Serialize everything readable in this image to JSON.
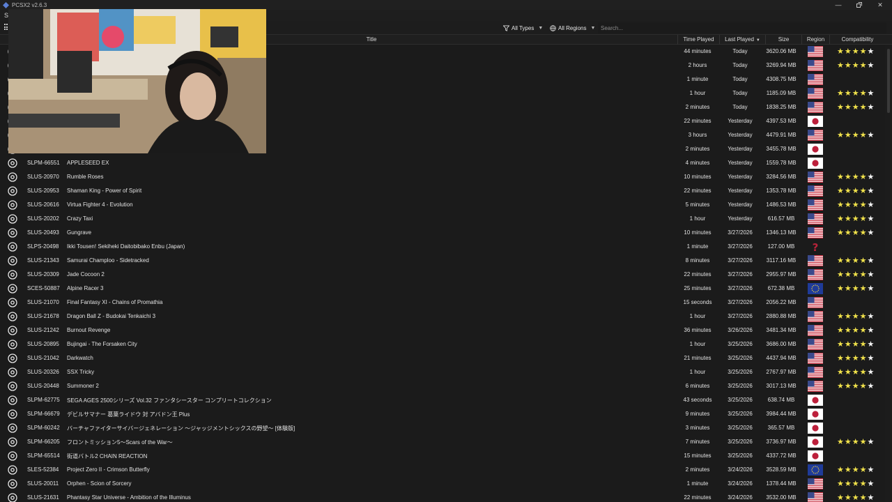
{
  "window": {
    "title": "PCSX2 v2.6.3"
  },
  "menubar": {
    "first_item": "S"
  },
  "toolbar": {
    "type_filter": "All Types",
    "region_filter": "All Regions",
    "search_placeholder": "Search..."
  },
  "columns": {
    "title": "Title",
    "time_played": "Time Played",
    "last_played": "Last Played",
    "size": "Size",
    "region": "Region",
    "compatibility": "Compatibility"
  },
  "colors": {
    "background": "#1b1b1b",
    "star_filled": "#f1e24b",
    "star_empty": "#f4f4f4"
  },
  "games": [
    {
      "serial": "",
      "title": "",
      "time_played": "44 minutes",
      "last_played": "Today",
      "size": "3620.06 MB",
      "region": "us",
      "stars": 4
    },
    {
      "serial": "",
      "title": "",
      "time_played": "2 hours",
      "last_played": "Today",
      "size": "3269.94 MB",
      "region": "us",
      "stars": 4
    },
    {
      "serial": "",
      "title": "",
      "time_played": "1 minute",
      "last_played": "Today",
      "size": "4308.75 MB",
      "region": "us",
      "stars": 0
    },
    {
      "serial": "",
      "title": "",
      "time_played": "1 hour",
      "last_played": "Today",
      "size": "1185.09 MB",
      "region": "us",
      "stars": 4
    },
    {
      "serial": "",
      "title": "",
      "time_played": "2 minutes",
      "last_played": "Today",
      "size": "1838.25 MB",
      "region": "us",
      "stars": 4
    },
    {
      "serial": "",
      "title": "",
      "time_played": "22 minutes",
      "last_played": "Yesterday",
      "size": "4397.53 MB",
      "region": "jp",
      "stars": 0
    },
    {
      "serial": "",
      "title": "",
      "time_played": "3 hours",
      "last_played": "Yesterday",
      "size": "4479.91 MB",
      "region": "us",
      "stars": 4
    },
    {
      "serial": "",
      "title": "",
      "time_played": "2 minutes",
      "last_played": "Yesterday",
      "size": "3455.78 MB",
      "region": "jp",
      "stars": 0
    },
    {
      "serial": "SLPM-66551",
      "title": "APPLESEED EX",
      "time_played": "4 minutes",
      "last_played": "Yesterday",
      "size": "1559.78 MB",
      "region": "jp",
      "stars": 0
    },
    {
      "serial": "SLUS-20970",
      "title": "Rumble Roses",
      "time_played": "10 minutes",
      "last_played": "Yesterday",
      "size": "3284.56 MB",
      "region": "us",
      "stars": 4
    },
    {
      "serial": "SLUS-20953",
      "title": "Shaman King - Power of Spirit",
      "time_played": "22 minutes",
      "last_played": "Yesterday",
      "size": "1353.78 MB",
      "region": "us",
      "stars": 4
    },
    {
      "serial": "SLUS-20616",
      "title": "Virtua Fighter 4 - Evolution",
      "time_played": "5 minutes",
      "last_played": "Yesterday",
      "size": "1486.53 MB",
      "region": "us",
      "stars": 4
    },
    {
      "serial": "SLUS-20202",
      "title": "Crazy Taxi",
      "time_played": "1 hour",
      "last_played": "Yesterday",
      "size": "616.57 MB",
      "region": "us",
      "stars": 4
    },
    {
      "serial": "SLUS-20493",
      "title": "Gungrave",
      "time_played": "10 minutes",
      "last_played": "3/27/2026",
      "size": "1346.13 MB",
      "region": "us",
      "stars": 4
    },
    {
      "serial": "SLPS-20498",
      "title": "Ikki Tousen! Sekiheki Daitobibako Enbu (Japan)",
      "time_played": "1 minute",
      "last_played": "3/27/2026",
      "size": "127.00 MB",
      "region": "unknown",
      "stars": 0
    },
    {
      "serial": "SLUS-21343",
      "title": "Samurai Champloo - Sidetracked",
      "time_played": "8 minutes",
      "last_played": "3/27/2026",
      "size": "3117.16 MB",
      "region": "us",
      "stars": 4
    },
    {
      "serial": "SLUS-20309",
      "title": "Jade Cocoon 2",
      "time_played": "22 minutes",
      "last_played": "3/27/2026",
      "size": "2955.97 MB",
      "region": "us",
      "stars": 4
    },
    {
      "serial": "SCES-50887",
      "title": "Alpine Racer 3",
      "time_played": "25 minutes",
      "last_played": "3/27/2026",
      "size": "672.38 MB",
      "region": "eu",
      "stars": 4
    },
    {
      "serial": "SLUS-21070",
      "title": "Final Fantasy XI - Chains of Promathia",
      "time_played": "15 seconds",
      "last_played": "3/27/2026",
      "size": "2056.22 MB",
      "region": "us",
      "stars": 0
    },
    {
      "serial": "SLUS-21678",
      "title": "Dragon Ball Z - Budokai Tenkaichi 3",
      "time_played": "1 hour",
      "last_played": "3/27/2026",
      "size": "2880.88 MB",
      "region": "us",
      "stars": 4
    },
    {
      "serial": "SLUS-21242",
      "title": "Burnout Revenge",
      "time_played": "36 minutes",
      "last_played": "3/26/2026",
      "size": "3481.34 MB",
      "region": "us",
      "stars": 4
    },
    {
      "serial": "SLUS-20895",
      "title": "Bujingai - The Forsaken City",
      "time_played": "1 hour",
      "last_played": "3/25/2026",
      "size": "3686.00 MB",
      "region": "us",
      "stars": 4
    },
    {
      "serial": "SLUS-21042",
      "title": "Darkwatch",
      "time_played": "21 minutes",
      "last_played": "3/25/2026",
      "size": "4437.94 MB",
      "region": "us",
      "stars": 4
    },
    {
      "serial": "SLUS-20326",
      "title": "SSX Tricky",
      "time_played": "1 hour",
      "last_played": "3/25/2026",
      "size": "2767.97 MB",
      "region": "us",
      "stars": 4
    },
    {
      "serial": "SLUS-20448",
      "title": "Summoner 2",
      "time_played": "6 minutes",
      "last_played": "3/25/2026",
      "size": "3017.13 MB",
      "region": "us",
      "stars": 4
    },
    {
      "serial": "SLPM-62775",
      "title": "SEGA AGES 2500シリーズ Vol.32 ファンタシースター コンプリートコレクション",
      "time_played": "43 seconds",
      "last_played": "3/25/2026",
      "size": "638.74 MB",
      "region": "jp",
      "stars": 0
    },
    {
      "serial": "SLPM-66679",
      "title": "デビルサマナー 葛葉ライドウ 対 アバドン王 Plus",
      "time_played": "9 minutes",
      "last_played": "3/25/2026",
      "size": "3984.44 MB",
      "region": "jp",
      "stars": 0
    },
    {
      "serial": "SLPM-60242",
      "title": "バーチャファイターサイバージェネレーション ～ジャッジメントシックスの野望～ [体験版]",
      "time_played": "3 minutes",
      "last_played": "3/25/2026",
      "size": "365.57 MB",
      "region": "jp",
      "stars": 0
    },
    {
      "serial": "SLPM-66205",
      "title": "フロントミッション5～Scars of the War～",
      "time_played": "7 minutes",
      "last_played": "3/25/2026",
      "size": "3736.97 MB",
      "region": "jp",
      "stars": 4
    },
    {
      "serial": "SLPM-65514",
      "title": "街道バトル2 CHAIN REACTION",
      "time_played": "15 minutes",
      "last_played": "3/25/2026",
      "size": "4337.72 MB",
      "region": "jp",
      "stars": 0
    },
    {
      "serial": "SLES-52384",
      "title": "Project Zero II - Crimson Butterfly",
      "time_played": "2 minutes",
      "last_played": "3/24/2026",
      "size": "3528.59 MB",
      "region": "eu",
      "stars": 4
    },
    {
      "serial": "SLUS-20011",
      "title": "Orphen - Scion of Sorcery",
      "time_played": "1 minute",
      "last_played": "3/24/2026",
      "size": "1378.44 MB",
      "region": "us",
      "stars": 4
    },
    {
      "serial": "SLUS-21631",
      "title": "Phantasy Star Universe - Ambition of the Illuminus",
      "time_played": "22 minutes",
      "last_played": "3/24/2026",
      "size": "3532.00 MB",
      "region": "us",
      "stars": 4
    }
  ]
}
